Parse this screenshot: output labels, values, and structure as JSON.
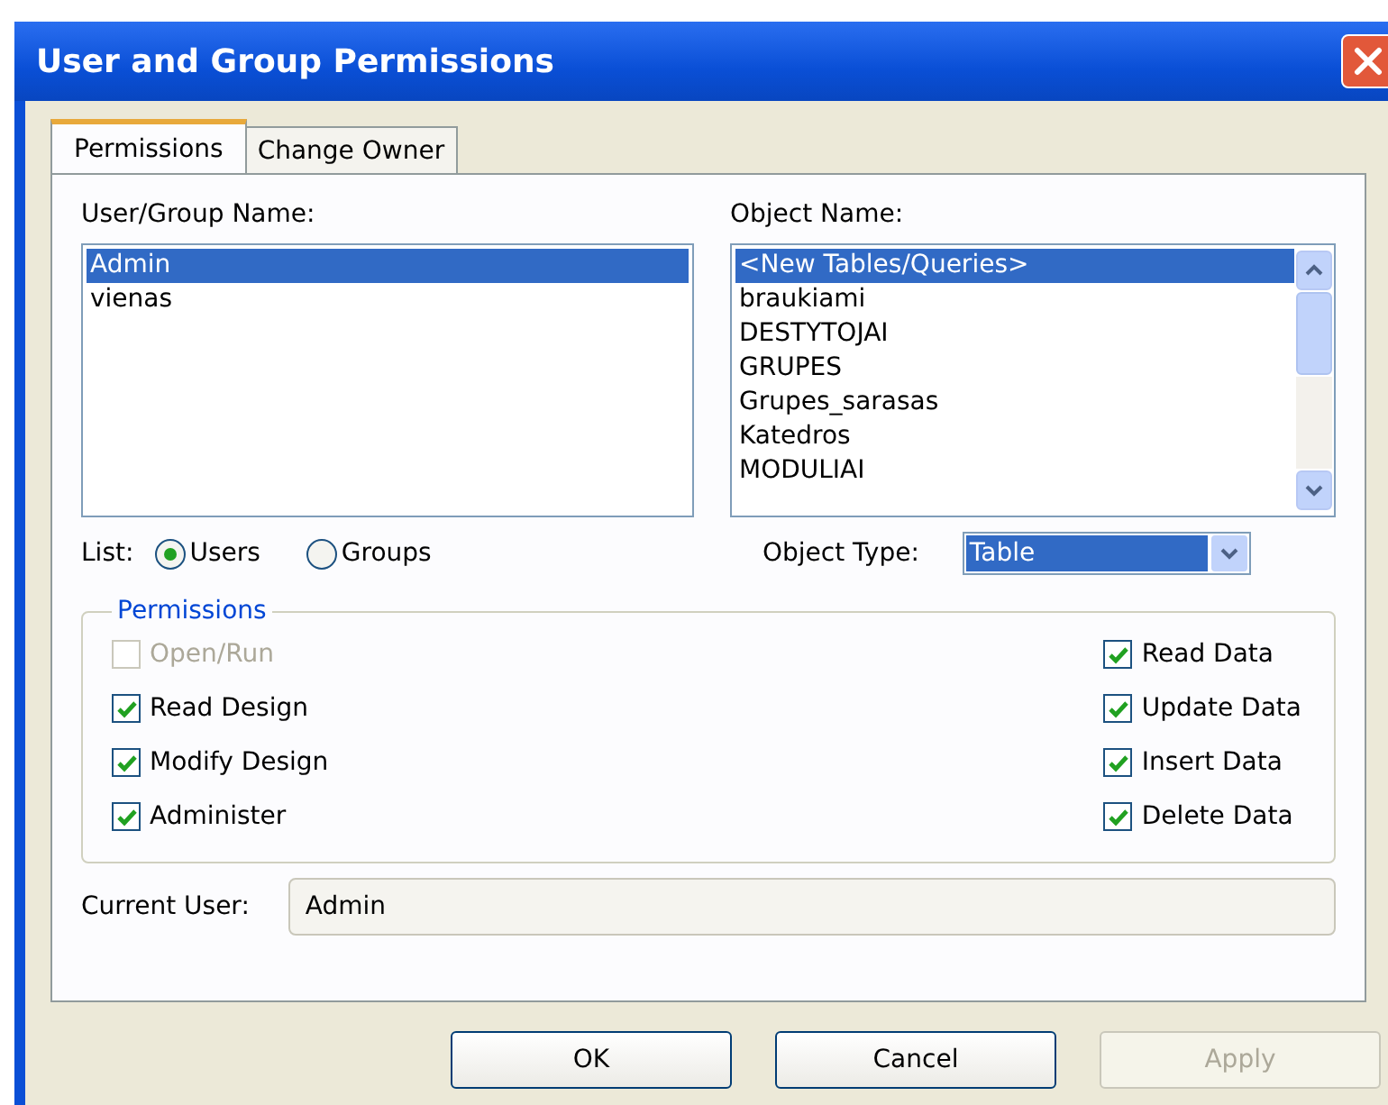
{
  "window": {
    "title": "User and Group Permissions"
  },
  "tabs": [
    {
      "label": "Permissions",
      "selected": true
    },
    {
      "label": "Change Owner",
      "selected": false
    }
  ],
  "user_group": {
    "label": "User/Group Name:",
    "items": [
      {
        "label": "Admin",
        "selected": true
      },
      {
        "label": "vienas",
        "selected": false
      }
    ]
  },
  "object_name": {
    "label": "Object Name:",
    "items": [
      {
        "label": "<New Tables/Queries>",
        "selected": true
      },
      {
        "label": "braukiami",
        "selected": false
      },
      {
        "label": "DESTYTOJAI",
        "selected": false
      },
      {
        "label": "GRUPES",
        "selected": false
      },
      {
        "label": "Grupes_sarasas",
        "selected": false
      },
      {
        "label": "Katedros",
        "selected": false
      },
      {
        "label": "MODULIAI",
        "selected": false
      }
    ]
  },
  "list": {
    "label": "List:",
    "options": [
      {
        "label": "Users",
        "selected": true
      },
      {
        "label": "Groups",
        "selected": false
      }
    ]
  },
  "object_type": {
    "label": "Object Type:",
    "value": "Table"
  },
  "permissions": {
    "title": "Permissions",
    "left": [
      {
        "label": "Open/Run",
        "checked": false,
        "disabled": true
      },
      {
        "label": "Read Design",
        "checked": true,
        "disabled": false
      },
      {
        "label": "Modify Design",
        "checked": true,
        "disabled": false
      },
      {
        "label": "Administer",
        "checked": true,
        "disabled": false
      }
    ],
    "right": [
      {
        "label": "Read Data",
        "checked": true,
        "disabled": false
      },
      {
        "label": "Update Data",
        "checked": true,
        "disabled": false
      },
      {
        "label": "Insert Data",
        "checked": true,
        "disabled": false
      },
      {
        "label": "Delete Data",
        "checked": true,
        "disabled": false
      }
    ]
  },
  "current_user": {
    "label": "Current User:",
    "value": "Admin"
  },
  "buttons": [
    {
      "label": "OK",
      "disabled": false
    },
    {
      "label": "Cancel",
      "disabled": false
    },
    {
      "label": "Apply",
      "disabled": true
    }
  ]
}
